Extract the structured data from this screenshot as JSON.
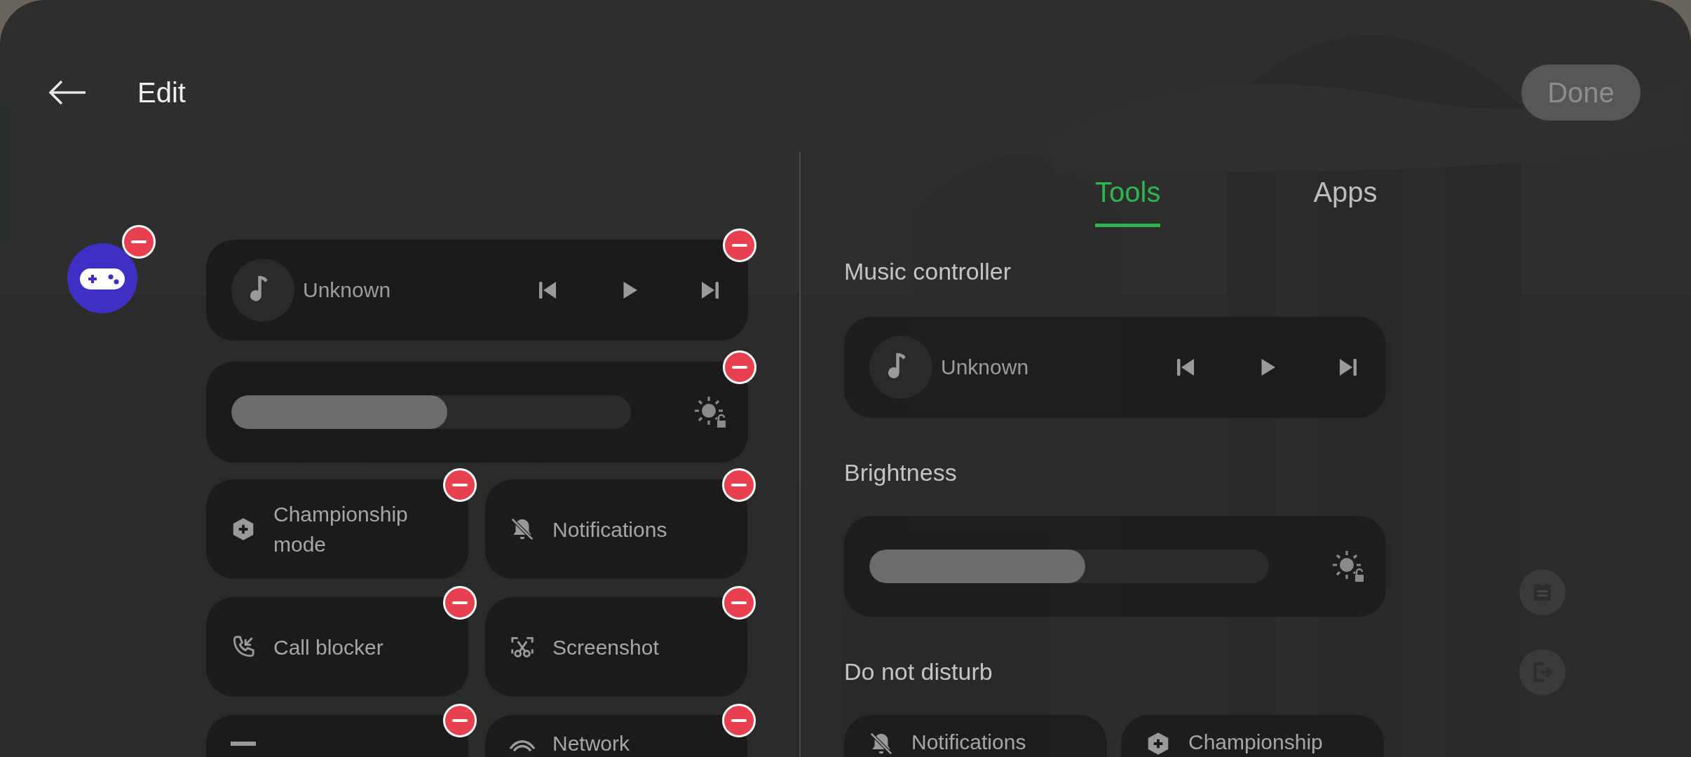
{
  "header": {
    "title": "Edit",
    "done": {
      "label": "Done",
      "disabled": true
    }
  },
  "current": {
    "game_app": {
      "removable": true
    },
    "widgets": [
      {
        "kind": "music",
        "title": "Unknown",
        "removable": true
      },
      {
        "kind": "brightness",
        "level": 0.54,
        "removable": true
      }
    ],
    "tiles": [
      {
        "kind": "championship",
        "label": "Championship mode",
        "removable": true
      },
      {
        "kind": "notifications",
        "label": "Notifications",
        "removable": true
      },
      {
        "kind": "call",
        "label": "Call blocker",
        "removable": true
      },
      {
        "kind": "screenshot",
        "label": "Screenshot",
        "removable": true
      },
      {
        "kind": "square",
        "removable": true
      },
      {
        "kind": "network",
        "label": "Network",
        "removable": true
      }
    ]
  },
  "tabs": [
    {
      "label": "Tools",
      "selected": true
    },
    {
      "label": "Apps",
      "selected": false
    }
  ],
  "sections": [
    {
      "title": "Music controller",
      "kind": "music",
      "track": "Unknown"
    },
    {
      "title": "Brightness",
      "kind": "brightness",
      "level": 0.54
    },
    {
      "title": "Do not disturb",
      "kind": "tiles",
      "tiles": [
        {
          "kind": "notifications",
          "label": "Notifications"
        },
        {
          "kind": "championship",
          "label": "Championship"
        }
      ]
    }
  ]
}
